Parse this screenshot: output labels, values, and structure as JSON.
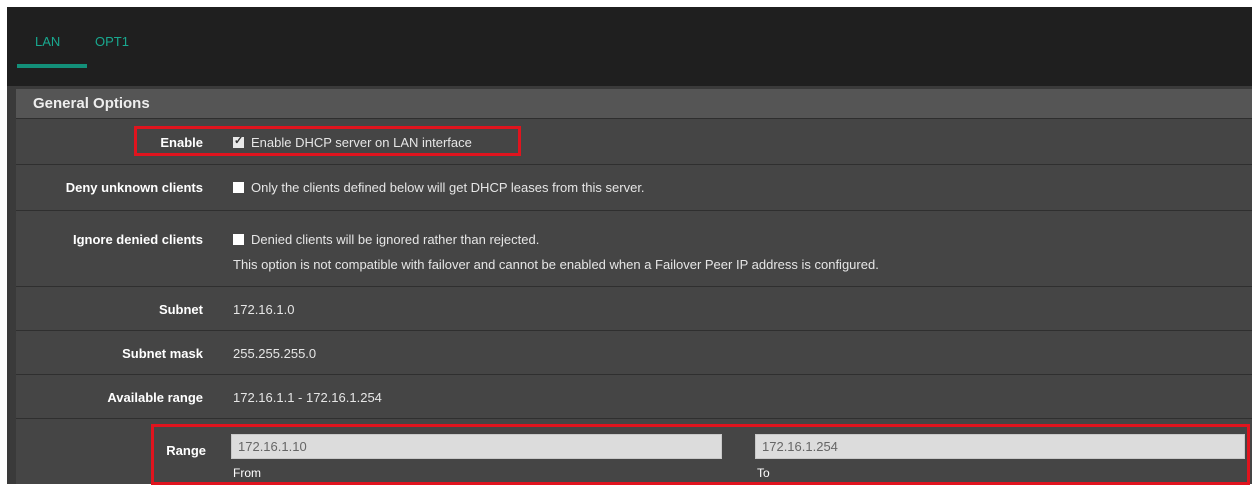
{
  "tabs": [
    {
      "label": "LAN",
      "active": true
    },
    {
      "label": "OPT1",
      "active": false
    }
  ],
  "section": {
    "title": "General Options"
  },
  "rows": {
    "enable": {
      "label": "Enable",
      "checkbox_text": "Enable DHCP server on LAN interface",
      "checked": true
    },
    "deny": {
      "label": "Deny unknown clients",
      "checkbox_text": "Only the clients defined below will get DHCP leases from this server.",
      "checked": false
    },
    "ignore": {
      "label": "Ignore denied clients",
      "checkbox_text": "Denied clients will be ignored rather than rejected.",
      "note": "This option is not compatible with failover and cannot be enabled when a Failover Peer IP address is configured.",
      "checked": false
    },
    "subnet": {
      "label": "Subnet",
      "value": "172.16.1.0"
    },
    "subnet_mask": {
      "label": "Subnet mask",
      "value": "255.255.255.0"
    },
    "available_range": {
      "label": "Available range",
      "value": "172.16.1.1 - 172.16.1.254"
    },
    "range": {
      "label": "Range",
      "from_value": "172.16.1.10",
      "from_help": "From",
      "to_value": "172.16.1.254",
      "to_help": "To"
    }
  },
  "colors": {
    "accent": "#19a88f",
    "highlight": "#e0141e"
  }
}
